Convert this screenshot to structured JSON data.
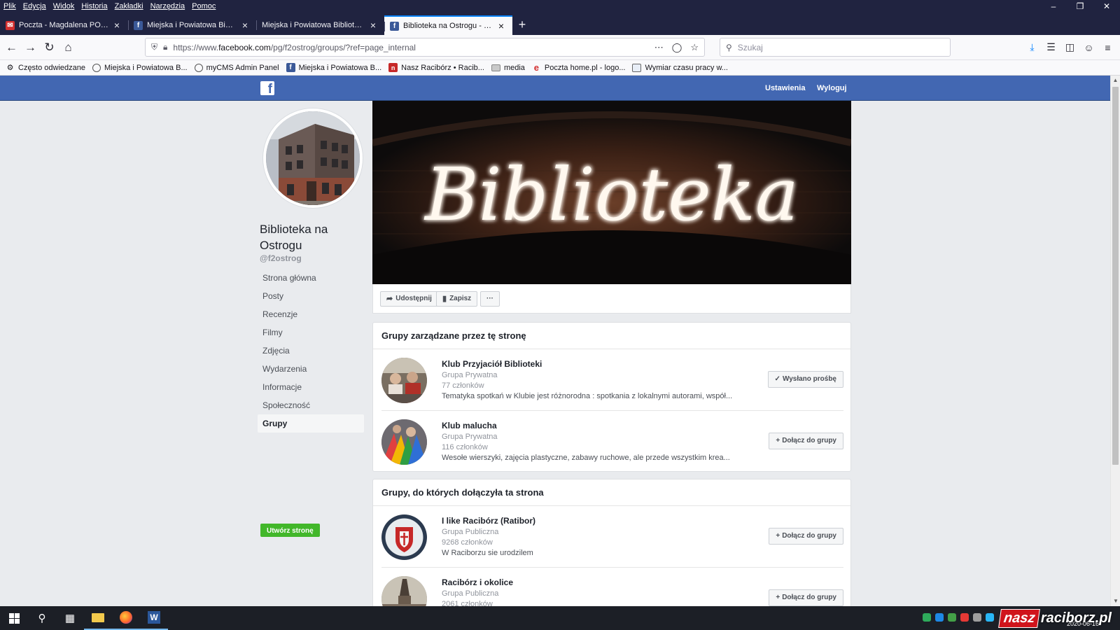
{
  "browser": {
    "menu": [
      "Plik",
      "Edycja",
      "Widok",
      "Historia",
      "Zakładki",
      "Narzędzia",
      "Pomoc"
    ],
    "tabs": [
      {
        "title": "Poczta - Magdalena PORDZIK - I",
        "icon": "mail-icon"
      },
      {
        "title": "Miejska i Powiatowa Biblioteka",
        "icon": "facebook-icon"
      },
      {
        "title": "Miejska i Powiatowa Biblioteka Pub",
        "icon": "none"
      },
      {
        "title": "Biblioteka na Ostrogu - Grupy",
        "icon": "facebook-icon"
      }
    ],
    "url_prefix": "https://www.",
    "url_domain": "facebook.com",
    "url_path": "/pg/f2ostrog/groups/?ref=page_internal",
    "search_placeholder": "Szukaj",
    "bookmarks": [
      {
        "label": "Często odwiedzane",
        "icon": "gear-icon"
      },
      {
        "label": "Miejska i Powiatowa B...",
        "icon": "globe-icon"
      },
      {
        "label": "myCMS Admin Panel",
        "icon": "globe-icon"
      },
      {
        "label": "Miejska i Powiatowa B...",
        "icon": "facebook-icon"
      },
      {
        "label": "Nasz Racibórz • Racib...",
        "icon": "nr-icon"
      },
      {
        "label": "media",
        "icon": "folder-icon"
      },
      {
        "label": "Poczta home.pl - logo...",
        "icon": "e-icon"
      },
      {
        "label": "Wymiar czasu pracy w...",
        "icon": "calendar-icon"
      }
    ]
  },
  "facebook": {
    "nav_settings": "Ustawienia",
    "nav_logout": "Wyloguj",
    "page_name": "Biblioteka na Ostrogu",
    "page_handle": "@f2ostrog",
    "sidebar": [
      {
        "label": "Strona główna"
      },
      {
        "label": "Posty"
      },
      {
        "label": "Recenzje"
      },
      {
        "label": "Filmy"
      },
      {
        "label": "Zdjęcia"
      },
      {
        "label": "Wydarzenia"
      },
      {
        "label": "Informacje"
      },
      {
        "label": "Społeczność"
      },
      {
        "label": "Grupy",
        "active": true
      }
    ],
    "create_page": "Utwórz stronę",
    "cover_text": "Biblioteka",
    "actions": {
      "share": "Udostępnij",
      "save": "Zapisz",
      "more": "···"
    },
    "managed_header": "Grupy zarządzane przez tę stronę",
    "managed_groups": [
      {
        "name": "Klub Przyjaciół Biblioteki",
        "privacy": "Grupa Prywatna",
        "members": "77 członków",
        "desc": "Tematyka spotkań w Klubie jest różnorodna : spotkania z lokalnymi autorami, współ...",
        "button": "Wysłano prośbę",
        "button_icon": "check-icon"
      },
      {
        "name": "Klub malucha",
        "privacy": "Grupa Prywatna",
        "members": "116 członków",
        "desc": "Wesołe wierszyki, zajęcia plastyczne, zabawy ruchowe, ale przede wszystkim krea...",
        "button": "Dołącz do grupy",
        "button_icon": "plus-icon"
      }
    ],
    "joined_header": "Grupy, do których dołączyła ta strona",
    "joined_groups": [
      {
        "name": "I like Racibórz (Ratibor)",
        "privacy": "Grupa Publiczna",
        "members": "9268 członków",
        "desc": "W Raciborzu sie urodzilem",
        "button": "Dołącz do grupy",
        "button_icon": "plus-icon"
      },
      {
        "name": "Racibórz i okolice",
        "privacy": "Grupa Publiczna",
        "members": "2061 członków",
        "desc": "",
        "button": "Dołącz do grupy",
        "button_icon": "plus-icon"
      }
    ]
  },
  "taskbar": {
    "date": "2020-06-16",
    "watermark_a": "nasz",
    "watermark_b": "raciborz.pl"
  }
}
